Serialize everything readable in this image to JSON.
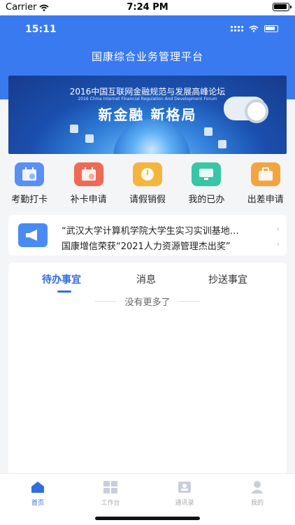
{
  "status_bar": {
    "carrier": "Carrier",
    "time": "7:24 PM"
  },
  "app_header": {
    "inner_time": "15:11",
    "title": "国康综合业务管理平台"
  },
  "banner": {
    "title": "2016中国互联网金融规范与发展高峰论坛",
    "subtitle": "2016 China Internet Financial Regulation And Development Forum",
    "headline": "新金融  新格局"
  },
  "quick_actions": [
    {
      "label": "考勤打卡",
      "color": "#5b8ff5",
      "icon": "calendar-icon"
    },
    {
      "label": "补卡申请",
      "color": "#ef6a55",
      "icon": "calendar-plus-icon"
    },
    {
      "label": "请假销假",
      "color": "#f4b53f",
      "icon": "clock-icon"
    },
    {
      "label": "我的已办",
      "color": "#39c6a4",
      "icon": "monitor-icon"
    },
    {
      "label": "出差申请",
      "color": "#f4a43f",
      "icon": "briefcase-icon"
    }
  ],
  "notices": [
    "“武汉大学计算机学院大学生实习实训基地…",
    "国康增信荣获“2021人力资源管理杰出奖”"
  ],
  "tabs": [
    {
      "label": "待办事宜",
      "active": true
    },
    {
      "label": "消息",
      "active": false
    },
    {
      "label": "抄送事宜",
      "active": false
    }
  ],
  "empty_text": "没有更多了",
  "tabbar": [
    {
      "label": "首页",
      "active": true
    },
    {
      "label": "工作台",
      "active": false
    },
    {
      "label": "通讯录",
      "active": false
    },
    {
      "label": "我的",
      "active": false
    }
  ],
  "colors": {
    "primary": "#3a7af0",
    "accent": "#2f6de1"
  }
}
